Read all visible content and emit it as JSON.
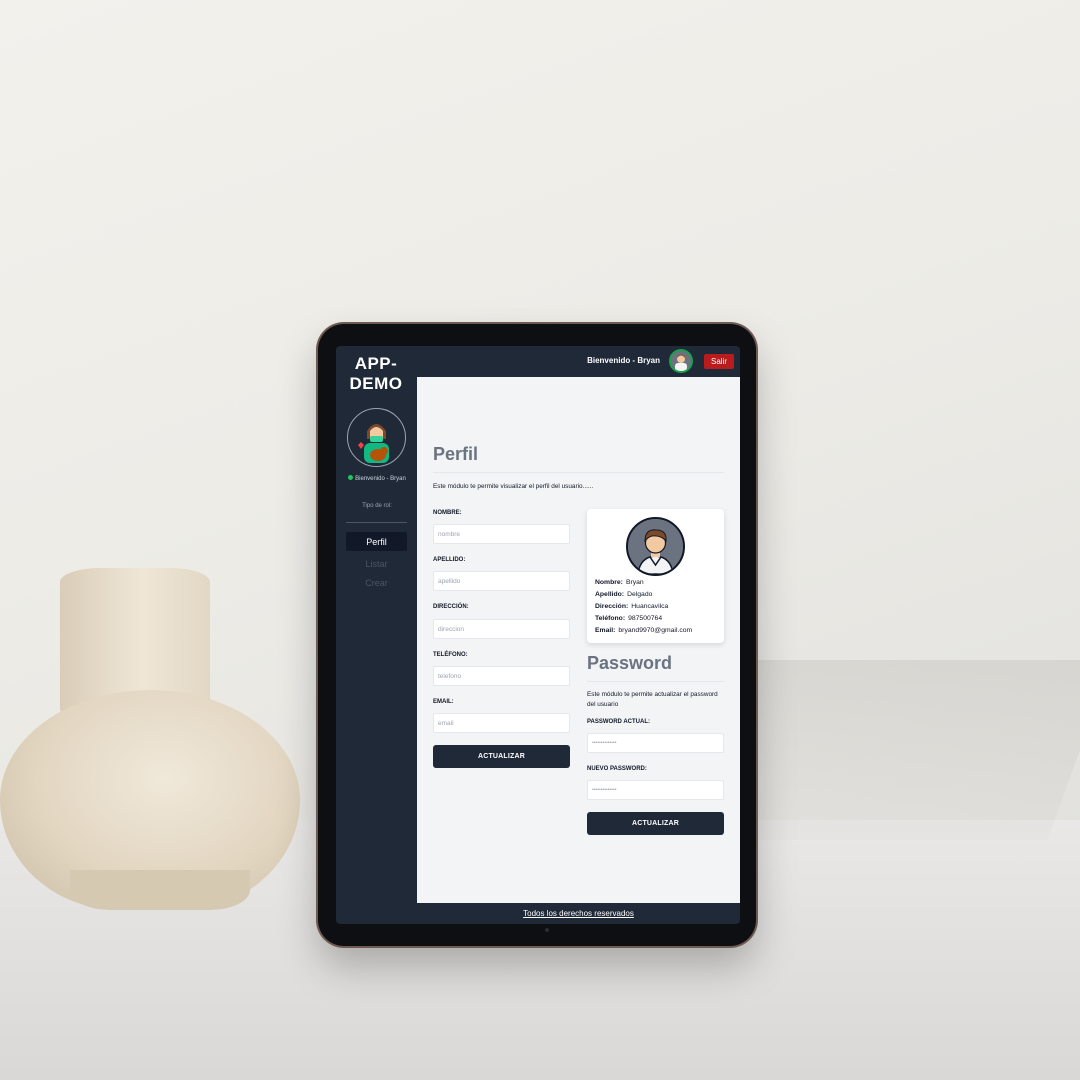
{
  "app": {
    "title": "APP- DEMO"
  },
  "topbar": {
    "welcome": "Bienvenido - Bryan",
    "logout_label": "Salir",
    "avatar_icon": "user-avatar-icon"
  },
  "sidebar": {
    "welcome": "Bienvenido - Bryan",
    "role": "Tipo de rol:",
    "avatar_icon": "vet-avatar-icon",
    "items": [
      {
        "label": "Perfil",
        "active": true
      },
      {
        "label": "Listar",
        "active": false
      },
      {
        "label": "Crear",
        "active": false
      }
    ]
  },
  "profile": {
    "title": "Perfil",
    "description": "Este módulo te permite visualizar el perfil del usuario......",
    "fields": [
      {
        "label": "NOMBRE:",
        "placeholder": "nombre"
      },
      {
        "label": "APELLIDO:",
        "placeholder": "apellido"
      },
      {
        "label": "DIRECCIÓN:",
        "placeholder": "direccion"
      },
      {
        "label": "TELÉFONO:",
        "placeholder": "telefono"
      },
      {
        "label": "EMAIL:",
        "placeholder": "email"
      }
    ],
    "submit_label": "ACTUALIZAR"
  },
  "card": {
    "rows": [
      {
        "key": "Nombre:",
        "value": "Bryan"
      },
      {
        "key": "Apellido:",
        "value": "Delgado"
      },
      {
        "key": "Dirección:",
        "value": "Huancavilca"
      },
      {
        "key": "Teléfono:",
        "value": "987500764"
      },
      {
        "key": "Email:",
        "value": "bryand9970@gmail.com"
      }
    ]
  },
  "password": {
    "title": "Password",
    "description": "Este módulo te permite actualizar el password del usuario",
    "current_label": "PASSWORD ACTUAL:",
    "current_value": "••••••••••••••",
    "new_label": "NUEVO PASSWORD:",
    "new_value": "••••••••••••••",
    "submit_label": "ACTUALIZAR"
  },
  "footer": {
    "text": "Todos los derechos reservados"
  },
  "colors": {
    "sidebar_bg": "#1f2937",
    "main_bg": "#f3f4f6",
    "logout_red": "#b91c1c",
    "online_green": "#22c55e"
  }
}
